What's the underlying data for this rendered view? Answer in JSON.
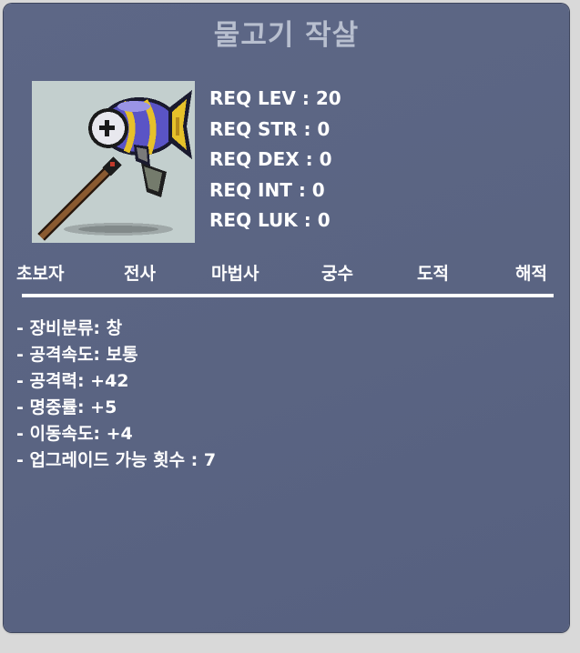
{
  "item": {
    "name": "물고기 작살",
    "image": "fish-harpoon-polearm-icon"
  },
  "requirements": [
    "REQ LEV : 20",
    "REQ STR : 0",
    "REQ DEX : 0",
    "REQ INT : 0",
    "REQ LUK : 0"
  ],
  "jobs": [
    "초보자",
    "전사",
    "마법사",
    "궁수",
    "도적",
    "해적"
  ],
  "stats": [
    "- 장비분류: 창",
    "- 공격속도: 보통",
    "- 공격력: +42",
    "- 명중률: +5",
    "- 이동속도: +4",
    "- 업그레이드 가능 횟수 : 7"
  ],
  "colors": {
    "panel": "#5b6584",
    "title": "#b8bfcf",
    "text": "#ffffff",
    "image_bg": "#c3cfce"
  }
}
